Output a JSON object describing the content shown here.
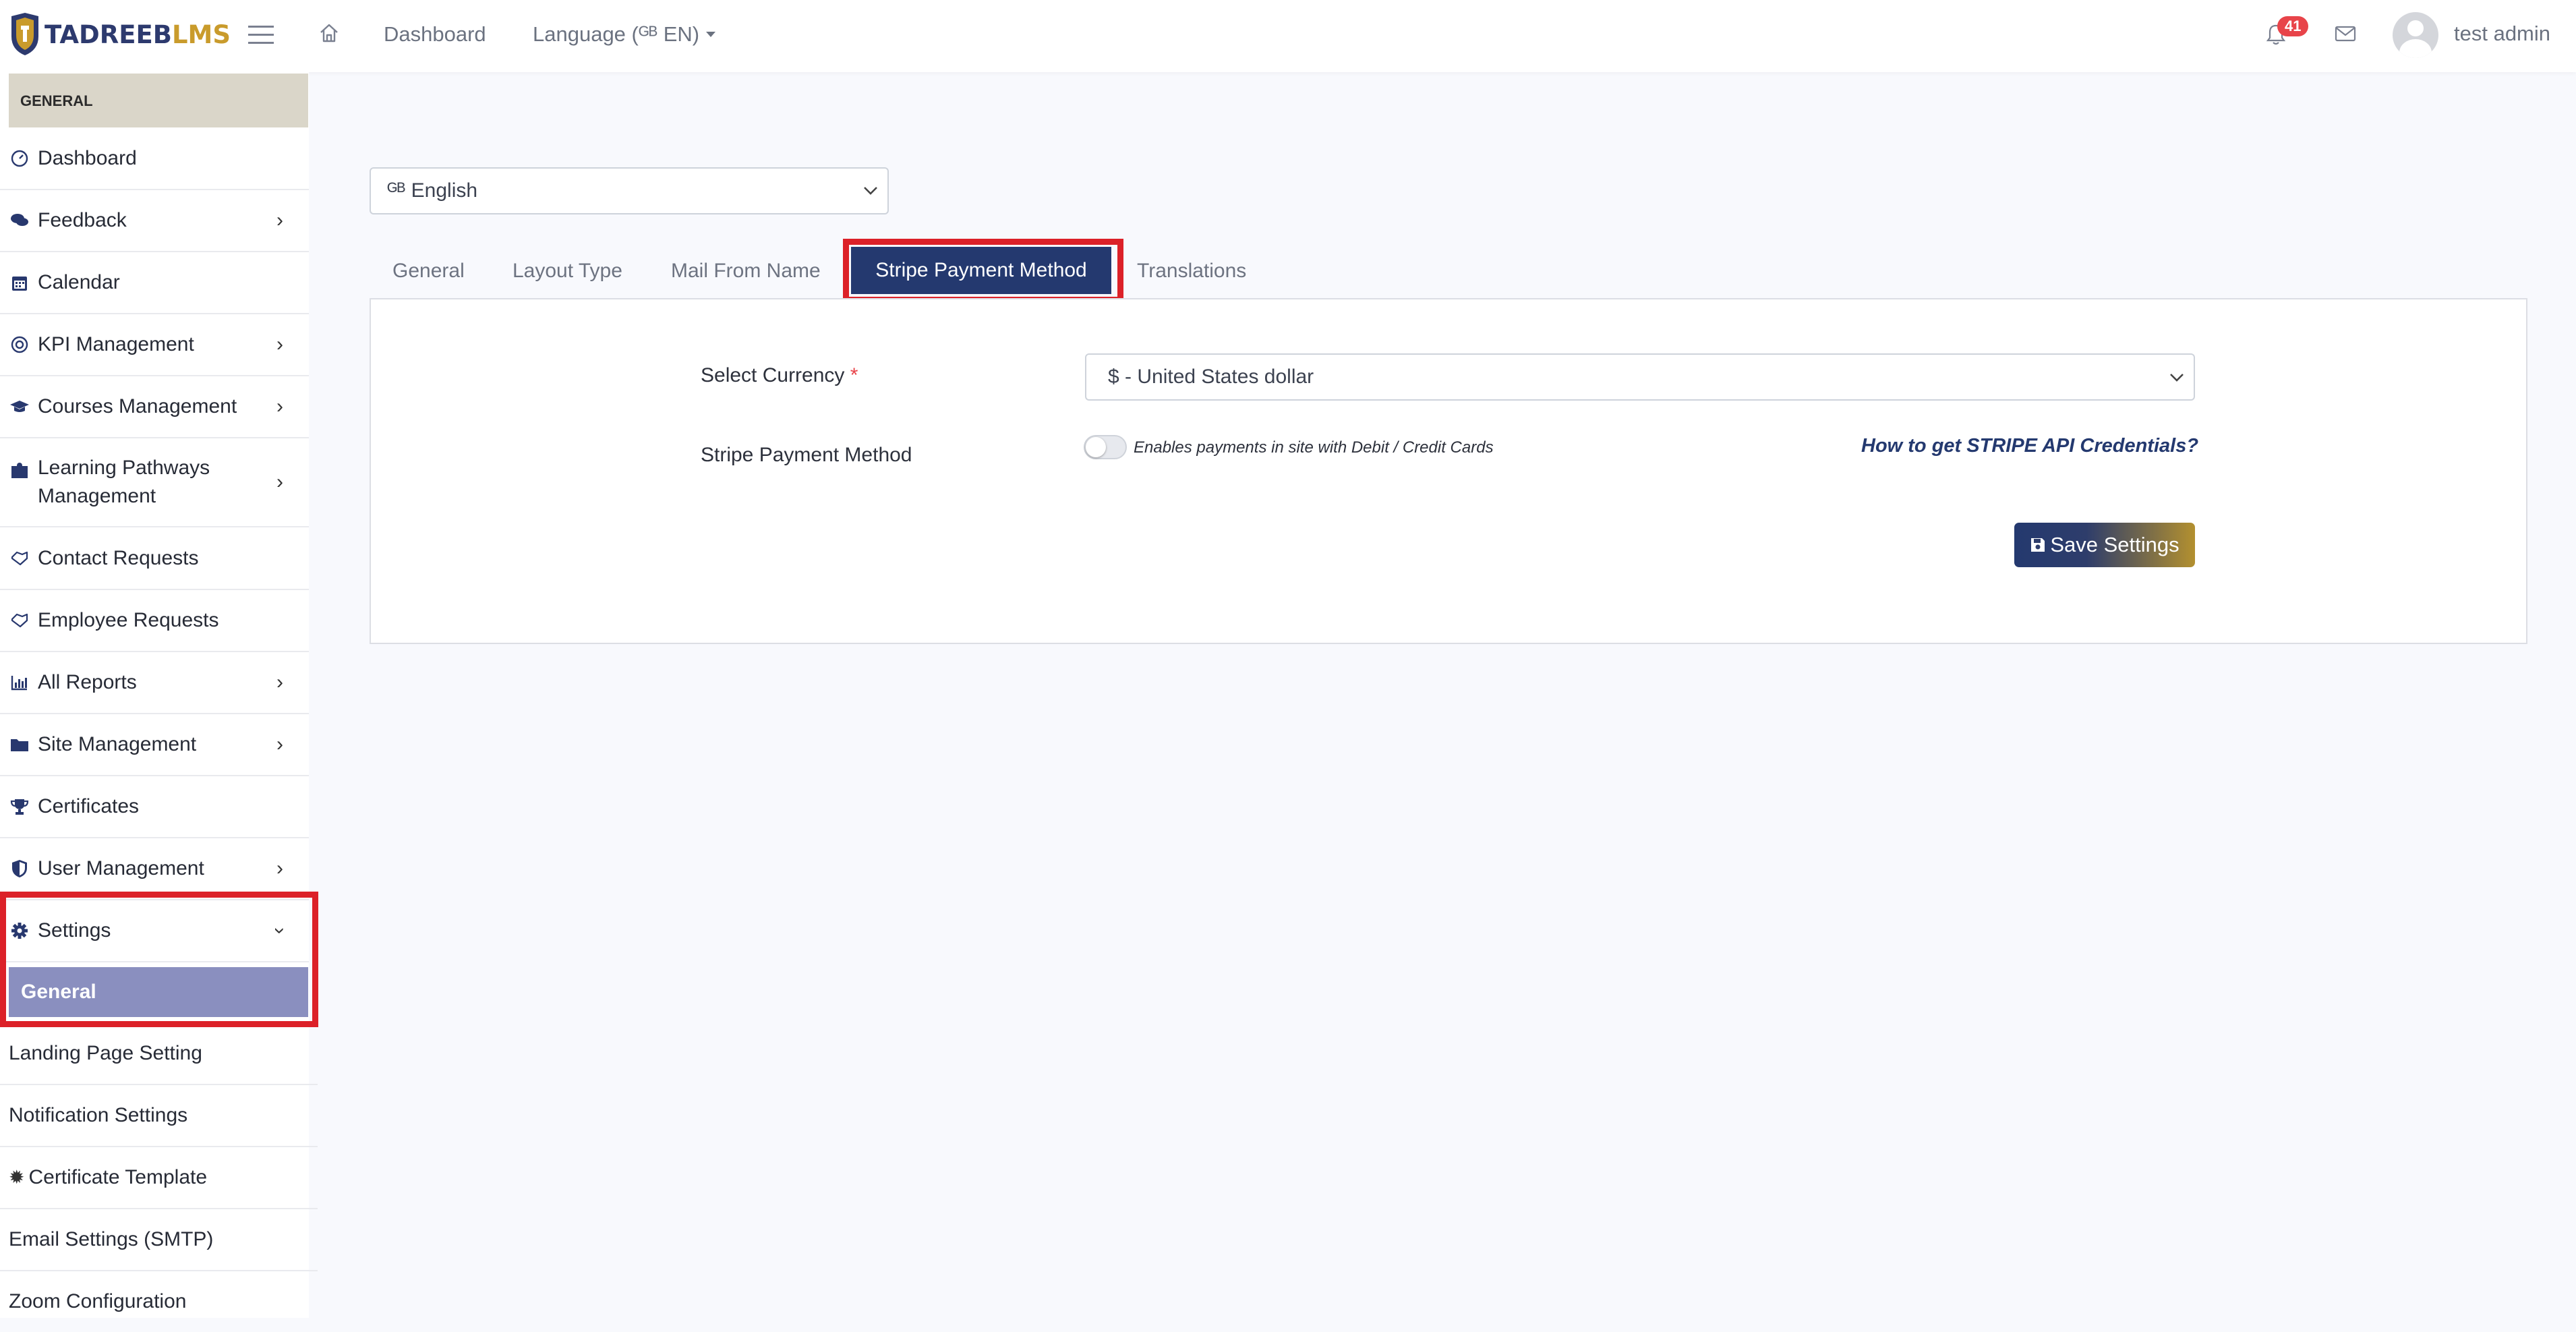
{
  "header": {
    "logo_part1": "TADREEB",
    "logo_part2": "LMS",
    "nav_dashboard": "Dashboard",
    "nav_language": "Language (ᴳᴮ EN)",
    "notification_count": "41",
    "user_name": "test admin",
    "icons": [
      "hamburger-icon",
      "home-icon",
      "caret-down-icon",
      "bell-icon",
      "mail-icon",
      "avatar"
    ]
  },
  "sidebar": {
    "section_title": "GENERAL",
    "items": [
      {
        "label": "Dashboard",
        "icon": "gauge-icon",
        "has_children": false
      },
      {
        "label": "Feedback",
        "icon": "comments-icon",
        "has_children": true
      },
      {
        "label": "Calendar",
        "icon": "calendar-icon",
        "has_children": false
      },
      {
        "label": "KPI Management",
        "icon": "target-icon",
        "has_children": true
      },
      {
        "label": "Courses Management",
        "icon": "graduation-cap-icon",
        "has_children": true
      },
      {
        "label": "Learning Pathways",
        "label_line2": "Management",
        "icon": "puzzle-icon",
        "has_children": true
      },
      {
        "label": "Contact Requests",
        "icon": "handshake-icon",
        "has_children": false
      },
      {
        "label": "Employee Requests",
        "icon": "handshake-icon",
        "has_children": false
      },
      {
        "label": "All Reports",
        "icon": "chart-icon",
        "has_children": true
      },
      {
        "label": "Site Management",
        "icon": "folder-icon",
        "has_children": true
      },
      {
        "label": "Certificates",
        "icon": "trophy-icon",
        "has_children": false
      },
      {
        "label": "User Management",
        "icon": "shield-icon",
        "has_children": true
      },
      {
        "label": "Settings",
        "icon": "gear-icon",
        "has_children": true,
        "expanded": true
      }
    ],
    "settings_children": [
      {
        "label": "General",
        "active": true
      },
      {
        "label": "Landing Page Setting"
      },
      {
        "label": "Notification Settings"
      },
      {
        "label": "Certificate Template"
      },
      {
        "label": "Email Settings (SMTP)"
      },
      {
        "label": "Zoom Configuration"
      }
    ]
  },
  "language_select": {
    "value": "ᴳᴮ English"
  },
  "tabs": [
    {
      "label": "General",
      "active": false
    },
    {
      "label": "Layout Type",
      "active": false
    },
    {
      "label": "Mail From Name",
      "active": false
    },
    {
      "label": "Stripe Payment Method",
      "active": true
    },
    {
      "label": "Translations",
      "active": false
    }
  ],
  "stripe_form": {
    "currency_label": "Select Currency",
    "required_mark": "*",
    "currency_value": "$ - United States dollar",
    "stripe_label": "Stripe Payment Method",
    "toggle_on": false,
    "toggle_hint": "Enables payments in site with Debit / Credit Cards",
    "credentials_link": "How to get STRIPE API Credentials?",
    "save_label": "Save Settings"
  },
  "colors": {
    "brand_navy": "#2d3a6e",
    "brand_gold": "#c99b2c",
    "active_tab": "#24396f",
    "active_sub_item": "#8a8fbf",
    "highlight_red": "#dc2128",
    "badge_red": "#e8444a"
  }
}
